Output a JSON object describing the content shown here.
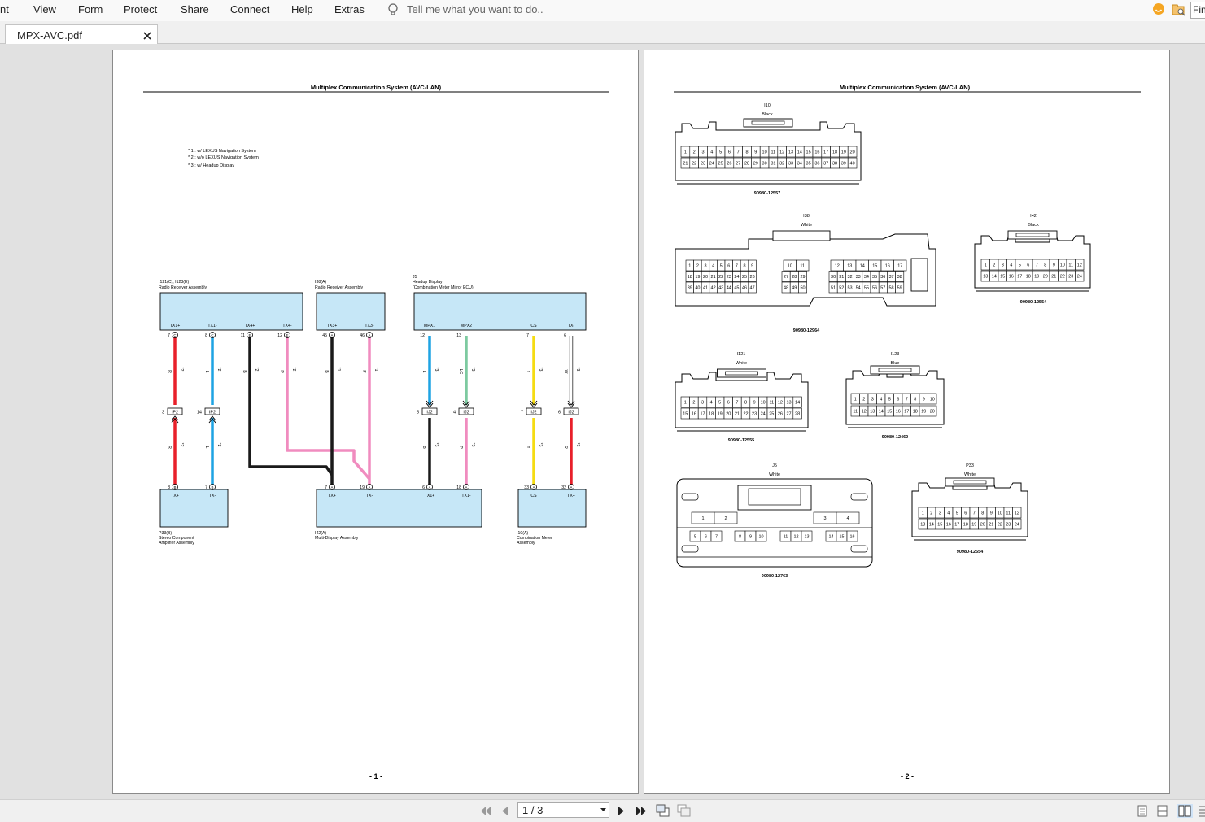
{
  "menu": {
    "items": [
      "nt",
      "View",
      "Form",
      "Protect",
      "Share",
      "Connect",
      "Help",
      "Extras"
    ],
    "tell_me": "Tell me what you want to do..",
    "find_stub": "Fin"
  },
  "tab": {
    "name": "MPX-AVC.pdf"
  },
  "pager": {
    "value": "1 / 3"
  },
  "colors": {
    "red": "#e8202a",
    "blue": "#1ea3e3",
    "black": "#1a1a1a",
    "pink": "#f08cbf",
    "green": "#7dcaa0",
    "yellow": "#f5dc12",
    "white": "#ffffff",
    "box": "#c6e7f7"
  },
  "page1": {
    "title": "Multiplex Communication System (AVC-LAN)",
    "notes": [
      "* 1 : w/ LEXUS Navigation System",
      "* 2 : w/o LEXUS Navigation System",
      "* 3 : w/ Headup Display"
    ],
    "page_number": "- 1 -",
    "components": {
      "radio_receiver": {
        "code": "I121(C), I123(E)",
        "name": "Radio Receiver Assembly",
        "pins": [
          "TX1+",
          "TX1-",
          "TX4+",
          "TX4-"
        ]
      },
      "radio_receiver2": {
        "code": "I38(A)",
        "name": "Radio Receiver Assembly",
        "pins": [
          "TX3+",
          "TX3-"
        ]
      },
      "headup": {
        "code": "J5",
        "name": "Headup Display",
        "name2": "(Combination Meter Mirror ECU)",
        "pins": [
          "MPX1",
          "MPX2",
          "CS",
          "TX-"
        ]
      },
      "stereo_amp": {
        "code": "P33(B)",
        "name": "Stereo Component",
        "name2": "Amplifier Assembly",
        "pins": [
          "TX+",
          "TX-"
        ]
      },
      "multi_display": {
        "code": "I42(A)",
        "name": "Multi-Display Assembly",
        "pins": [
          "TX+",
          "TX-",
          "TX1+",
          "TX1-"
        ]
      },
      "combo_meter": {
        "code": "I10(A)",
        "name": "Combination Meter",
        "name2": "Assembly",
        "pins": [
          "CS",
          "TX+"
        ]
      }
    },
    "pin_numbers": {
      "top": [
        "7",
        "8",
        "11",
        "12",
        "45",
        "46",
        "12",
        "13",
        "7",
        "6"
      ],
      "bottom": [
        "8",
        "7",
        "7",
        "19",
        "6",
        "18",
        "33",
        "32"
      ],
      "junction": [
        "3",
        "14",
        "5",
        "4",
        "7",
        "6"
      ]
    },
    "pin_letters": {
      "top": [
        "C",
        "C",
        "E",
        "E",
        "A",
        "A",
        "",
        "",
        "",
        ""
      ],
      "bottom": [
        "B",
        "B",
        "A",
        "A",
        "A",
        "A",
        "A",
        "A"
      ]
    },
    "junction_labels": [
      "IP2",
      "IP2",
      "IJ2",
      "IJ2",
      "IJ2",
      "IJ2"
    ],
    "wire_colors": {
      "upper": [
        "R",
        "L",
        "B",
        "P",
        "B",
        "P",
        "L",
        "LG",
        "Y",
        "W"
      ],
      "lower": [
        "R",
        "L",
        "B",
        "P",
        "Y",
        "R"
      ]
    },
    "wire_notes": {
      "upper": [
        "*2",
        "*2",
        "*2",
        "*2",
        "*1",
        "*1",
        "*3",
        "*3",
        "*3",
        "*3"
      ],
      "lower": [
        "*2",
        "*2",
        "*3",
        "*3",
        "*3",
        "*3"
      ]
    }
  },
  "page2": {
    "title": "Multiplex Communication System (AVC-LAN)",
    "page_number": "- 2 -",
    "connectors": [
      {
        "code": "I10",
        "color": "Black",
        "part": "90980-12557",
        "rows": [
          [
            "1",
            "2",
            "3",
            "4",
            "5",
            "6",
            "7",
            "8",
            "9",
            "10",
            "11",
            "12",
            "13",
            "14",
            "15",
            "16",
            "17",
            "18",
            "19",
            "20"
          ],
          [
            "21",
            "22",
            "23",
            "24",
            "25",
            "26",
            "27",
            "28",
            "29",
            "30",
            "31",
            "32",
            "33",
            "34",
            "35",
            "36",
            "37",
            "38",
            "39",
            "40"
          ]
        ]
      },
      {
        "code": "I38",
        "color": "White",
        "part": "90980-12964",
        "groups": [
          [
            [
              "1",
              "2",
              "3",
              "4",
              "5",
              "6",
              "7",
              "8",
              "9"
            ],
            [
              "18",
              "19",
              "20",
              "21",
              "22",
              "23",
              "24",
              "25",
              "26"
            ],
            [
              "39",
              "40",
              "41",
              "42",
              "43",
              "44",
              "45",
              "46",
              "47"
            ]
          ],
          [
            [
              "10",
              "11"
            ],
            [
              "27",
              "28",
              "29"
            ],
            [
              "48",
              "49",
              "50"
            ]
          ],
          [
            [
              "12",
              "13",
              "14",
              "15",
              "16",
              "17"
            ],
            [
              "30",
              "31",
              "32",
              "33",
              "34",
              "35",
              "36",
              "37",
              "38"
            ],
            [
              "51",
              "52",
              "53",
              "54",
              "55",
              "56",
              "57",
              "58",
              "59"
            ]
          ]
        ]
      },
      {
        "code": "I42",
        "color": "Black",
        "part": "90980-12554",
        "rows": [
          [
            "1",
            "2",
            "3",
            "4",
            "5",
            "6",
            "7",
            "8",
            "9",
            "10",
            "11",
            "12"
          ],
          [
            "13",
            "14",
            "15",
            "16",
            "17",
            "18",
            "19",
            "20",
            "21",
            "22",
            "23",
            "24"
          ]
        ]
      },
      {
        "code": "I121",
        "color": "White",
        "part": "90980-12555",
        "rows": [
          [
            "1",
            "2",
            "3",
            "4",
            "5",
            "6",
            "7",
            "8",
            "9",
            "10",
            "11",
            "12",
            "13",
            "14"
          ],
          [
            "15",
            "16",
            "17",
            "18",
            "19",
            "20",
            "21",
            "22",
            "23",
            "24",
            "25",
            "26",
            "27",
            "28"
          ]
        ]
      },
      {
        "code": "I123",
        "color": "Blue",
        "part": "90980-12460",
        "rows": [
          [
            "1",
            "2",
            "3",
            "4",
            "5",
            "6",
            "7",
            "8",
            "9",
            "10"
          ],
          [
            "11",
            "12",
            "13",
            "14",
            "15",
            "16",
            "17",
            "18",
            "19",
            "20"
          ]
        ]
      },
      {
        "code": "J5",
        "color": "White",
        "part": "90980-12763",
        "rows": [
          [
            "1",
            "2",
            "3",
            "4"
          ],
          [
            "5",
            "6",
            "7",
            "8",
            "9",
            "10",
            "11",
            "12",
            "13",
            "14",
            "15",
            "16"
          ]
        ]
      },
      {
        "code": "P33",
        "color": "White",
        "part": "90980-12554",
        "rows": [
          [
            "1",
            "2",
            "3",
            "4",
            "5",
            "6",
            "7",
            "8",
            "9",
            "10",
            "11",
            "12"
          ],
          [
            "13",
            "14",
            "15",
            "16",
            "17",
            "18",
            "19",
            "20",
            "21",
            "22",
            "23",
            "24"
          ]
        ]
      }
    ]
  }
}
